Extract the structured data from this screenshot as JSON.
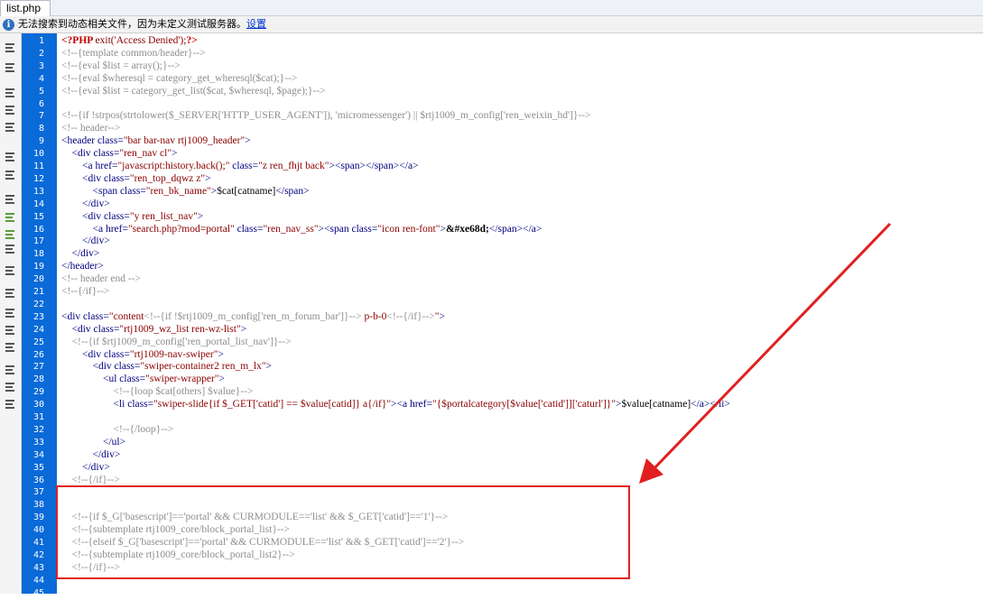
{
  "tab": {
    "label": "list.php"
  },
  "infobar": {
    "message": "无法搜索到动态相关文件，因为未定义测试服务器。",
    "link": "设置"
  },
  "toolbar_icons": [
    "open-documents-icon",
    "show-code-navigator-icon",
    "collapse-full-tag-icon",
    "collapse-selection-icon",
    "expand-all-icon",
    "select-parent-tag-icon",
    "balance-braces-icon",
    "line-numbers-icon",
    "highlight-invalid-code-icon",
    "word-wrap-icon",
    "syntax-coloring-icon",
    "apply-comment-icon",
    "remove-comment-icon",
    "wrap-tag-icon",
    "recent-snippets-icon",
    "move-css-icon",
    "indent-code-icon",
    "outdent-code-icon",
    "format-source-icon"
  ],
  "colors": {
    "gutter": "#0a6ad8",
    "highlight_box": "#e02020",
    "arrow": "#e02020"
  },
  "line_numbers": [
    "1",
    "2",
    "3",
    "4",
    "5",
    "6",
    "7",
    "8",
    "9",
    "10",
    "11",
    "12",
    "13",
    "14",
    "15",
    "16",
    "17",
    "18",
    "19",
    "20",
    "21",
    "22",
    "23",
    "24",
    "25",
    "26",
    "27",
    "28",
    "29",
    "30",
    "31",
    "32",
    "33",
    "34",
    "35",
    "36",
    "37",
    "38",
    "39",
    "40",
    "41",
    "42",
    "43",
    "44",
    "45"
  ],
  "code": [
    [
      {
        "t": "<?PHP ",
        "c": "php"
      },
      {
        "t": "exit(",
        "c": "fn"
      },
      {
        "t": "'Access Denied'",
        "c": "str"
      },
      {
        "t": ");",
        "c": "fn"
      },
      {
        "t": "?>",
        "c": "php"
      }
    ],
    [
      {
        "t": "<!--{template common/header}-->",
        "c": "cmt"
      }
    ],
    [
      {
        "t": "<!--{eval $list = array();}-->",
        "c": "cmt"
      }
    ],
    [
      {
        "t": "<!--{eval $wheresql = category_get_wheresql($cat);}-->",
        "c": "cmt"
      }
    ],
    [
      {
        "t": "<!--{eval $list = category_get_list($cat, $wheresql, $page);}-->",
        "c": "cmt"
      }
    ],
    [],
    [
      {
        "t": "<!--{if !strpos(strtolower($_SERVER['HTTP_USER_AGENT']), 'micromessenger') || $rtj1009_m_config['ren_weixin_hd']}-->",
        "c": "cmt"
      }
    ],
    [
      {
        "t": "<!-- header-->",
        "c": "cmt"
      }
    ],
    [
      {
        "t": "<header class=",
        "c": "tag"
      },
      {
        "t": "\"bar bar-nav rtj1009_header\"",
        "c": "str"
      },
      {
        "t": ">",
        "c": "tag"
      }
    ],
    [
      {
        "t": "    <div class=",
        "c": "tag"
      },
      {
        "t": "\"ren_nav cl\"",
        "c": "str"
      },
      {
        "t": ">",
        "c": "tag"
      }
    ],
    [
      {
        "t": "        <a href=",
        "c": "tag"
      },
      {
        "t": "\"javascript:history.back();\"",
        "c": "str"
      },
      {
        "t": " class=",
        "c": "tag"
      },
      {
        "t": "\"z ren_fhjt back\"",
        "c": "str"
      },
      {
        "t": "><span></span></a>",
        "c": "tag"
      }
    ],
    [
      {
        "t": "        <div class=",
        "c": "tag"
      },
      {
        "t": "\"ren_top_dqwz z\"",
        "c": "str"
      },
      {
        "t": ">",
        "c": "tag"
      }
    ],
    [
      {
        "t": "            <span class=",
        "c": "tag"
      },
      {
        "t": "\"ren_bk_name\"",
        "c": "str"
      },
      {
        "t": ">",
        "c": "tag"
      },
      {
        "t": "$cat[catname]",
        "c": "plain"
      },
      {
        "t": "</span>",
        "c": "tag"
      }
    ],
    [
      {
        "t": "        </div>",
        "c": "tag"
      }
    ],
    [
      {
        "t": "        <div class=",
        "c": "tag"
      },
      {
        "t": "\"y ren_list_nav\"",
        "c": "str"
      },
      {
        "t": ">",
        "c": "tag"
      }
    ],
    [
      {
        "t": "            <a href=",
        "c": "tag"
      },
      {
        "t": "\"search.php?mod=portal\"",
        "c": "str"
      },
      {
        "t": " class=",
        "c": "tag"
      },
      {
        "t": "\"ren_nav_ss\"",
        "c": "str"
      },
      {
        "t": "><span class=",
        "c": "tag"
      },
      {
        "t": "\"icon ren-font\"",
        "c": "str"
      },
      {
        "t": ">",
        "c": "tag"
      },
      {
        "t": "&#xe68d;",
        "c": "ent"
      },
      {
        "t": "</span></a>",
        "c": "tag"
      }
    ],
    [
      {
        "t": "        </div>",
        "c": "tag"
      }
    ],
    [
      {
        "t": "    </div>",
        "c": "tag"
      }
    ],
    [
      {
        "t": "</header>",
        "c": "tag"
      }
    ],
    [
      {
        "t": "<!-- header end -->",
        "c": "cmt"
      }
    ],
    [
      {
        "t": "<!--{/if}-->",
        "c": "cmt"
      }
    ],
    [],
    [
      {
        "t": "<div class=",
        "c": "tag"
      },
      {
        "t": "\"content",
        "c": "str"
      },
      {
        "t": "<!--{if !$rtj1009_m_config['ren_m_forum_bar']}-->",
        "c": "cmt"
      },
      {
        "t": " p-b-0",
        "c": "str"
      },
      {
        "t": "<!--{/if}-->",
        "c": "cmt"
      },
      {
        "t": "\"",
        "c": "str"
      },
      {
        "t": ">",
        "c": "tag"
      }
    ],
    [
      {
        "t": "    <div class=",
        "c": "tag"
      },
      {
        "t": "\"rtj1009_wz_list ren-wz-list\"",
        "c": "str"
      },
      {
        "t": ">",
        "c": "tag"
      }
    ],
    [
      {
        "t": "    <!--{if $rtj1009_m_config['ren_portal_list_nav']}-->",
        "c": "cmt"
      }
    ],
    [
      {
        "t": "        <div class=",
        "c": "tag"
      },
      {
        "t": "\"rtj1009-nav-swiper\"",
        "c": "str"
      },
      {
        "t": ">",
        "c": "tag"
      }
    ],
    [
      {
        "t": "            <div class=",
        "c": "tag"
      },
      {
        "t": "\"swiper-container2 ren_m_lx\"",
        "c": "str"
      },
      {
        "t": ">",
        "c": "tag"
      }
    ],
    [
      {
        "t": "                <ul class=",
        "c": "tag"
      },
      {
        "t": "\"swiper-wrapper\"",
        "c": "str"
      },
      {
        "t": ">",
        "c": "tag"
      }
    ],
    [
      {
        "t": "                    <!--{loop $cat[others] $value}-->",
        "c": "cmt"
      }
    ],
    [
      {
        "t": "                    <li class=",
        "c": "tag"
      },
      {
        "t": "\"swiper-slide{if $_GET['catid'] == $value[catid]} a{/if}\"",
        "c": "str"
      },
      {
        "t": "><a href=",
        "c": "tag"
      },
      {
        "t": "\"{$portalcategory[$value['catid']]['caturl']}\"",
        "c": "str"
      },
      {
        "t": ">",
        "c": "tag"
      },
      {
        "t": "$value[catname]",
        "c": "plain"
      },
      {
        "t": "</a></li>",
        "c": "tag"
      }
    ],
    [],
    [
      {
        "t": "                    <!--{/loop}-->",
        "c": "cmt"
      }
    ],
    [
      {
        "t": "                </ul>",
        "c": "tag"
      }
    ],
    [
      {
        "t": "            </div>",
        "c": "tag"
      }
    ],
    [
      {
        "t": "        </div>",
        "c": "tag"
      }
    ],
    [
      {
        "t": "    <!--{/if}-->",
        "c": "cmt"
      }
    ],
    [],
    [],
    [
      {
        "t": "    <!--{if $_G['basescript']=='portal' && CURMODULE=='list' && $_GET['catid']=='1'}-->",
        "c": "cmt"
      }
    ],
    [
      {
        "t": "    <!--{subtemplate rtj1009_core/block_portal_list}-->",
        "c": "cmt"
      }
    ],
    [
      {
        "t": "    <!--{elseif $_G['basescript']=='portal' && CURMODULE=='list' && $_GET['catid']=='2'}-->",
        "c": "cmt"
      }
    ],
    [
      {
        "t": "    <!--{subtemplate rtj1009_core/block_portal_list2}-->",
        "c": "cmt"
      }
    ],
    [
      {
        "t": "    <!--{/if}-->",
        "c": "cmt"
      }
    ],
    [],
    []
  ]
}
